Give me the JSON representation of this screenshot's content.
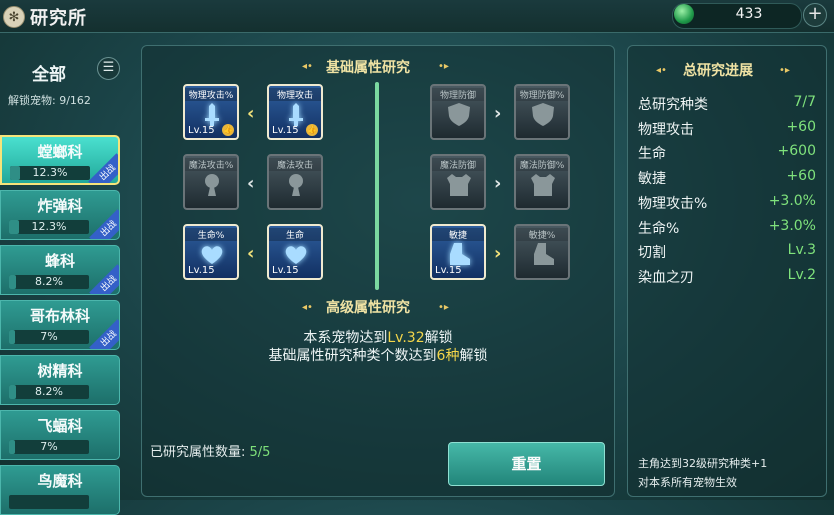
{
  "header": {
    "title": "研究所",
    "currency_value": "433",
    "add_label": "+"
  },
  "sidebar": {
    "filter_label": "全部",
    "menu_icon": "menu-icon",
    "unlock_text": "解锁宠物: 9/162",
    "deploy_badge": "出战",
    "families": [
      {
        "name": "螳螂科",
        "percent": "12.3%",
        "progress": 0.123,
        "deployed": true,
        "selected": true
      },
      {
        "name": "炸弹科",
        "percent": "12.3%",
        "progress": 0.123,
        "deployed": true,
        "selected": false
      },
      {
        "name": "蜂科",
        "percent": "8.2%",
        "progress": 0.082,
        "deployed": true,
        "selected": false
      },
      {
        "name": "哥布林科",
        "percent": "7%",
        "progress": 0.07,
        "deployed": true,
        "selected": false
      },
      {
        "name": "树精科",
        "percent": "8.2%",
        "progress": 0.082,
        "deployed": false,
        "selected": false
      },
      {
        "name": "飞蝠科",
        "percent": "7%",
        "progress": 0.07,
        "deployed": false,
        "selected": false
      },
      {
        "name": "鸟魔科",
        "percent": "",
        "progress": 0,
        "deployed": false,
        "selected": false
      }
    ]
  },
  "research": {
    "basic_title": "基础属性研究",
    "advanced_title": "高级属性研究",
    "nodes": [
      {
        "label": "物理攻击%",
        "level": "Lv.15",
        "active": true,
        "icon": "sword-icon"
      },
      {
        "label": "物理攻击",
        "level": "Lv.15",
        "active": true,
        "icon": "sword-icon"
      },
      {
        "label": "魔法攻击%",
        "level": "",
        "active": false,
        "icon": "magic-orb-icon"
      },
      {
        "label": "魔法攻击",
        "level": "",
        "active": false,
        "icon": "magic-orb-icon"
      },
      {
        "label": "生命%",
        "level": "Lv.15",
        "active": true,
        "icon": "heart-icon"
      },
      {
        "label": "生命",
        "level": "Lv.15",
        "active": true,
        "icon": "heart-icon"
      },
      {
        "label": "物理防御",
        "level": "",
        "active": false,
        "icon": "shield-icon"
      },
      {
        "label": "物理防御%",
        "level": "",
        "active": false,
        "icon": "shield-icon"
      },
      {
        "label": "魔法防御",
        "level": "",
        "active": false,
        "icon": "armor-icon"
      },
      {
        "label": "魔法防御%",
        "level": "",
        "active": false,
        "icon": "armor-icon"
      },
      {
        "label": "敏捷",
        "level": "Lv.15",
        "active": true,
        "icon": "boot-icon"
      },
      {
        "label": "敏捷%",
        "level": "",
        "active": false,
        "icon": "boot-icon"
      }
    ],
    "arrows": [
      "‹",
      "‹",
      "‹",
      "›",
      "›",
      "›"
    ],
    "adv_line1_pre": "本系宠物达到",
    "adv_line1_hl": "Lv.32",
    "adv_line1_post": "解锁",
    "adv_line2_pre": "基础属性研究种类个数达到",
    "adv_line2_hl": "6种",
    "adv_line2_post": "解锁",
    "researched_label": "已研究属性数量:",
    "researched_value": "5/5",
    "reset_label": "重置"
  },
  "progress": {
    "title": "总研究进展",
    "stats": [
      {
        "name": "总研究种类",
        "value": "7/7"
      },
      {
        "name": "物理攻击",
        "value": "+60"
      },
      {
        "name": "生命",
        "value": "+600"
      },
      {
        "name": "敏捷",
        "value": "+60"
      },
      {
        "name": "物理攻击%",
        "value": "+3.0%"
      },
      {
        "name": "生命%",
        "value": "+3.0%"
      },
      {
        "name": "切割",
        "value": "Lv.3"
      },
      {
        "name": "染血之刃",
        "value": "Lv.2"
      }
    ],
    "bonus_line1": "主角达到32级研究种类+1",
    "bonus_line2": "对本系所有宠物生效"
  },
  "colors": {
    "accent_gold": "#f2d54a",
    "stat_green": "#7fe27c",
    "selected_border": "#f6e47a"
  }
}
